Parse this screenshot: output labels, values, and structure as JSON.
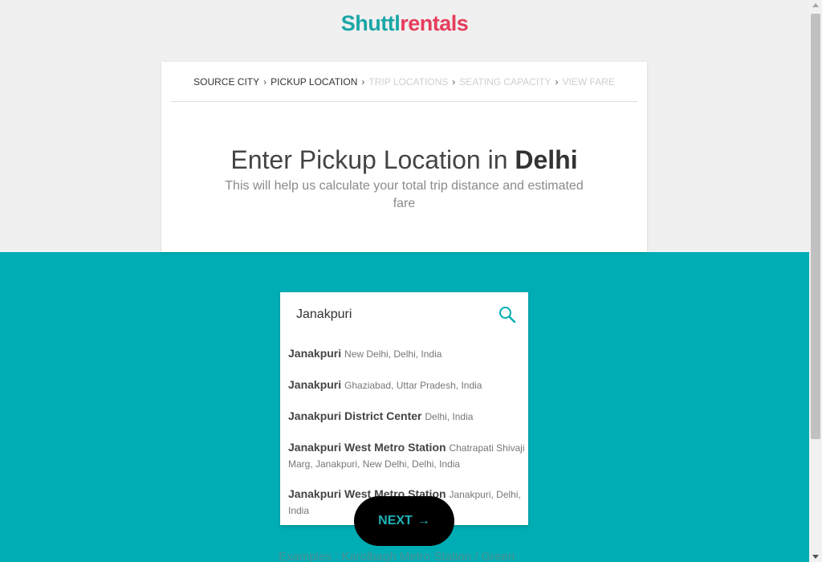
{
  "logo": {
    "part_a": "Shuttl",
    "part_b": "rentals"
  },
  "breadcrumb": [
    {
      "label": "SOURCE CITY",
      "active": true
    },
    {
      "label": "PICKUP LOCATION",
      "active": true
    },
    {
      "label": "TRIP LOCATIONS",
      "active": false
    },
    {
      "label": "SEATING CAPACITY",
      "active": false
    },
    {
      "label": "VIEW FARE",
      "active": false
    }
  ],
  "heading": {
    "prefix": "Enter Pickup Location in ",
    "city": "Delhi"
  },
  "subheading": "This will help us calculate your total trip distance and estimated fare",
  "search": {
    "value": "Janakpuri",
    "placeholder": ""
  },
  "suggestions": [
    {
      "main": "Janakpuri",
      "sub": "New Delhi, Delhi, India"
    },
    {
      "main": "Janakpuri",
      "sub": "Ghaziabad, Uttar Pradesh, India"
    },
    {
      "main": "Janakpuri District Center",
      "sub": "Delhi, India"
    },
    {
      "main": "Janakpuri West Metro Station",
      "sub": "Chatrapati Shivaji Marg, Janakpuri, New Delhi, Delhi, India"
    },
    {
      "main": "Janakpuri West Metro Station",
      "sub": "Janakpuri, Delhi, India"
    }
  ],
  "next_button": {
    "label": "NEXT",
    "arrow": "→"
  },
  "examples_text": "Examples : Karolbagh Metro Station / Green",
  "colors": {
    "teal": "#00adb4",
    "logo_teal": "#1aa6a6",
    "logo_red": "#e63d5c"
  }
}
